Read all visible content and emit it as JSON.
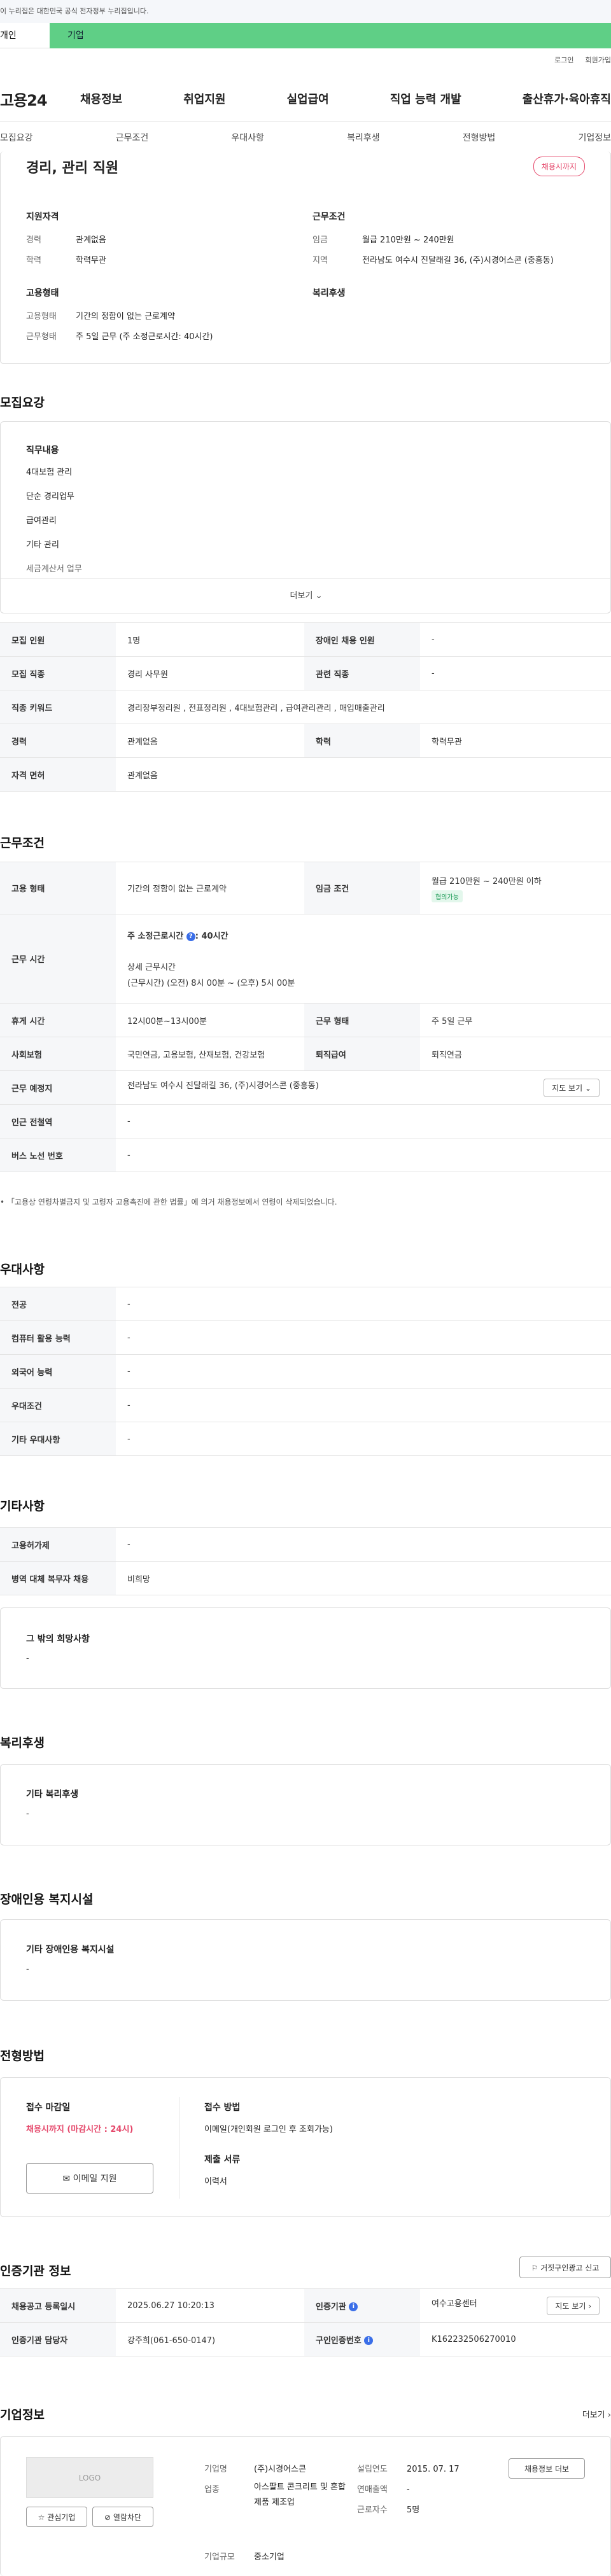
{
  "topbar": {
    "notice": "이 누리집은 대한민국 공식 전자정부 누리집입니다."
  },
  "switch": {
    "personal": "개인",
    "business": "기업"
  },
  "util": {
    "login": "로그인",
    "join": "회원가입"
  },
  "logo": "고용24",
  "gnb": [
    "채용정보",
    "취업지원",
    "실업급여",
    "직업 능력 개발",
    "출산휴가·육아휴직"
  ],
  "subtabs": [
    "모집요강",
    "근무조건",
    "우대사항",
    "복리후생",
    "전형방법",
    "기업정보"
  ],
  "summary": {
    "title": "경리, 관리 직원",
    "status_badge": "채용시까지",
    "qual_title": "지원자격",
    "qual": [
      {
        "k": "경력",
        "v": "관계없음"
      },
      {
        "k": "학력",
        "v": "학력무관"
      }
    ],
    "cond_title": "근무조건",
    "cond": [
      {
        "k": "임금",
        "v": "월급 210만원 ~ 240만원"
      },
      {
        "k": "지역",
        "v": "전라남도 여수시 진달래길 36, (주)시경어스콘 (중흥동)"
      }
    ],
    "emp_title": "고용형태",
    "emp": [
      {
        "k": "고용형태",
        "v": "기간의 정함이 없는 근로계약"
      },
      {
        "k": "근무형태",
        "v": "주 5일 근무 (주 소정근로시간: 40시간)"
      }
    ],
    "welfare_title": "복리후생"
  },
  "recruit": {
    "section_title": "모집요강",
    "duty_title": "직무내용",
    "duties": [
      "4대보험 관리",
      "단순 경리업무",
      "급여관리",
      "기타 관리",
      "세금계산서 업무"
    ],
    "more": "더보기",
    "rows": [
      [
        "모집 인원",
        "1명",
        "장애인 채용 인원",
        "-"
      ],
      [
        "모집 직종",
        "경리 사무원",
        "관련 직종",
        "-"
      ],
      [
        "직종 키워드",
        "경리장부정리원 , 전표정리원 , 4대보험관리 , 급여관리관리 , 매입매출관리"
      ],
      [
        "경력",
        "관계없음",
        "학력",
        "학력무관"
      ],
      [
        "자격 면허",
        "관계없음"
      ]
    ]
  },
  "work": {
    "section_title": "근무조건",
    "emp_type_k": "고용 형태",
    "emp_type_v": "기간의 정함이 없는 근로계약",
    "wage_k": "임금 조건",
    "wage_v": "월급 210만원 ~ 240만원 이하",
    "wage_chip": "협의가능",
    "hours_k": "근무 시간",
    "hours_v1": "주 소정근로시간",
    "hours_v1b": ": 40시간",
    "hours_v2": "상세 근무시간",
    "hours_v3": "(근무시간) (오전) 8시 00분 ~ (오후) 5시 00분",
    "rest_k": "휴게 시간",
    "rest_v": "12시00분~13시00분",
    "form_k": "근무 형태",
    "form_v": "주 5일 근무",
    "ins_k": "사회보험",
    "ins_v": "국민연금, 고용보험, 산재보험, 건강보험",
    "ret_k": "퇴직급여",
    "ret_v": "퇴직연금",
    "place_k": "근무 예정지",
    "place_v": "전라남도 여수시 진달래길 36, (주)시경어스콘 (중흥동)",
    "map_btn": "지도 보기",
    "subway_k": "인근 전철역",
    "subway_v": "-",
    "bus_k": "버스 노선 번호",
    "bus_v": "-",
    "note": "「고용상 연령차별금지 및 고령자 고용촉진에 관한 법률」에 의거 채용정보에서 연령이 삭제되었습니다."
  },
  "pref": {
    "section_title": "우대사항",
    "rows": [
      [
        "전공",
        "-"
      ],
      [
        "컴퓨터 활용 능력",
        "-"
      ],
      [
        "외국어 능력",
        "-"
      ],
      [
        "우대조건",
        "-"
      ],
      [
        "기타 우대사항",
        "-"
      ]
    ]
  },
  "etc": {
    "section_title": "기타사항",
    "rows": [
      [
        "고용허가제",
        "-"
      ],
      [
        "병역 대체 복무자 채용",
        "비희망"
      ]
    ],
    "other_title": "그 밖의 희망사항",
    "other_v": "-"
  },
  "welfare": {
    "section_title": "복리후생",
    "box_title": "기타 복리후생",
    "box_v": "-"
  },
  "disabled": {
    "section_title": "장애인용 복지시설",
    "box_title": "기타 장애인용 복지시설",
    "box_v": "-"
  },
  "apply": {
    "section_title": "전형방법",
    "deadline_title": "접수 마감일",
    "deadline_v": "채용시까지 (마감시간 : 24시)",
    "email_btn": "이메일 지원",
    "method_title": "접수 방법",
    "method_v": "이메일(개인회원 로그인 후 조회가능)",
    "docs_title": "제출 서류",
    "docs_v": "이력서"
  },
  "agency": {
    "section_title": "인증기관 정보",
    "report_btn": "거짓구인광고 신고",
    "reg_k": "채용공고 등록일시",
    "reg_v": "2025.06.27 10:20:13",
    "org_k": "인증기관",
    "org_v": "여수고용센터",
    "map_btn": "지도 보기",
    "mgr_k": "인증기관 담당자",
    "mgr_v": "강주희(061-650-0147)",
    "id_k": "구인인증번호",
    "id_v": "K162232506270010"
  },
  "company": {
    "section_title": "기업정보",
    "more": "더보기",
    "logo_text": "LOGO",
    "fav_btn": "관심기업",
    "block_btn": "열람차단",
    "name_k": "기업명",
    "name_v": "(주)시경어스콘",
    "ind_k": "업종",
    "ind_v": "아스팔트 콘크리트 및 혼합제품 제조업",
    "founded_k": "설립연도",
    "founded_v": "2015. 07. 17",
    "sales_k": "연매출액",
    "sales_v": "-",
    "emp_k": "근로자수",
    "emp_v": "5명",
    "size_k": "기업규모",
    "size_v": "중소기업",
    "jobs_btn": "채용정보 더보"
  }
}
